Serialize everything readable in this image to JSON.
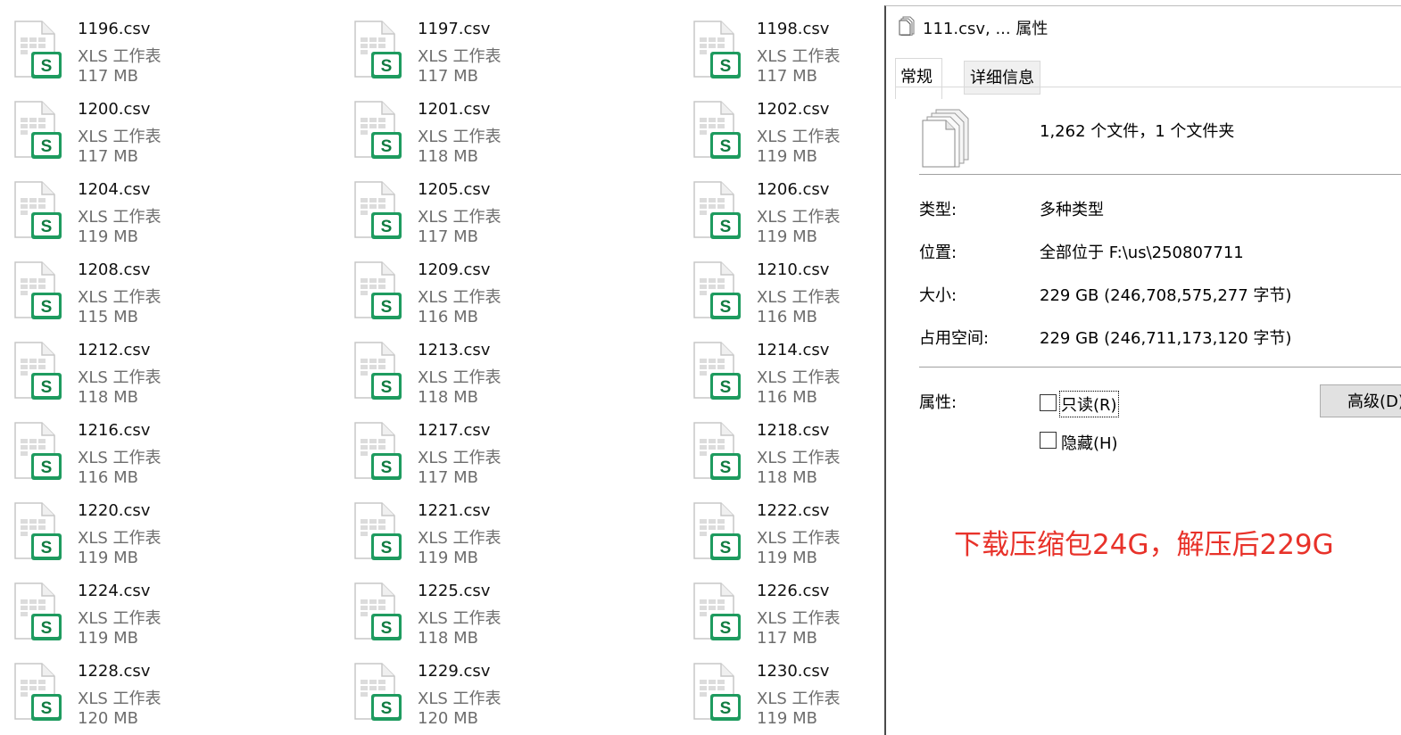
{
  "explorer": {
    "files": [
      {
        "name": "1196.csv",
        "type": "XLS 工作表",
        "size": "117 MB"
      },
      {
        "name": "1197.csv",
        "type": "XLS 工作表",
        "size": "117 MB"
      },
      {
        "name": "1198.csv",
        "type": "XLS 工作表",
        "size": "117 MB"
      },
      {
        "name": "1200.csv",
        "type": "XLS 工作表",
        "size": "117 MB"
      },
      {
        "name": "1201.csv",
        "type": "XLS 工作表",
        "size": "118 MB"
      },
      {
        "name": "1202.csv",
        "type": "XLS 工作表",
        "size": "119 MB"
      },
      {
        "name": "1204.csv",
        "type": "XLS 工作表",
        "size": "119 MB"
      },
      {
        "name": "1205.csv",
        "type": "XLS 工作表",
        "size": "117 MB"
      },
      {
        "name": "1206.csv",
        "type": "XLS 工作表",
        "size": "119 MB"
      },
      {
        "name": "1208.csv",
        "type": "XLS 工作表",
        "size": "115 MB"
      },
      {
        "name": "1209.csv",
        "type": "XLS 工作表",
        "size": "116 MB"
      },
      {
        "name": "1210.csv",
        "type": "XLS 工作表",
        "size": "116 MB"
      },
      {
        "name": "1212.csv",
        "type": "XLS 工作表",
        "size": "118 MB"
      },
      {
        "name": "1213.csv",
        "type": "XLS 工作表",
        "size": "118 MB"
      },
      {
        "name": "1214.csv",
        "type": "XLS 工作表",
        "size": "116 MB"
      },
      {
        "name": "1216.csv",
        "type": "XLS 工作表",
        "size": "116 MB"
      },
      {
        "name": "1217.csv",
        "type": "XLS 工作表",
        "size": "117 MB"
      },
      {
        "name": "1218.csv",
        "type": "XLS 工作表",
        "size": "118 MB"
      },
      {
        "name": "1220.csv",
        "type": "XLS 工作表",
        "size": "119 MB"
      },
      {
        "name": "1221.csv",
        "type": "XLS 工作表",
        "size": "119 MB"
      },
      {
        "name": "1222.csv",
        "type": "XLS 工作表",
        "size": "119 MB"
      },
      {
        "name": "1224.csv",
        "type": "XLS 工作表",
        "size": "119 MB"
      },
      {
        "name": "1225.csv",
        "type": "XLS 工作表",
        "size": "118 MB"
      },
      {
        "name": "1226.csv",
        "type": "XLS 工作表",
        "size": "117 MB"
      },
      {
        "name": "1228.csv",
        "type": "XLS 工作表",
        "size": "120 MB"
      },
      {
        "name": "1229.csv",
        "type": "XLS 工作表",
        "size": "120 MB"
      },
      {
        "name": "1230.csv",
        "type": "XLS 工作表",
        "size": "119 MB"
      }
    ],
    "icon": "spreadsheet-csv-icon",
    "icon_badge": "S",
    "colors": {
      "icon_green": "#21a366",
      "icon_dark_green": "#107c41",
      "muted_text": "#6d6d6d"
    }
  },
  "dialog": {
    "title": "111.csv, ... 属性",
    "tabs": {
      "general": "常规",
      "details": "详细信息"
    },
    "summary": "1,262 个文件，1 个文件夹",
    "type_label": "类型:",
    "type_value": "多种类型",
    "location_label": "位置:",
    "location_value": "全部位于 F:\\us\\250807711",
    "size_label": "大小:",
    "size_value": "229 GB (246,708,575,277 字节)",
    "disk_label": "占用空间:",
    "disk_value": "229 GB (246,711,173,120 字节)",
    "attributes_label": "属性:",
    "readonly_label": "只读(R)",
    "hidden_label": "隐藏(H)",
    "advanced_label": "高级(D)"
  },
  "annotation": {
    "text": "下载压缩包24G，解压后229G",
    "color": "#e8322a"
  }
}
